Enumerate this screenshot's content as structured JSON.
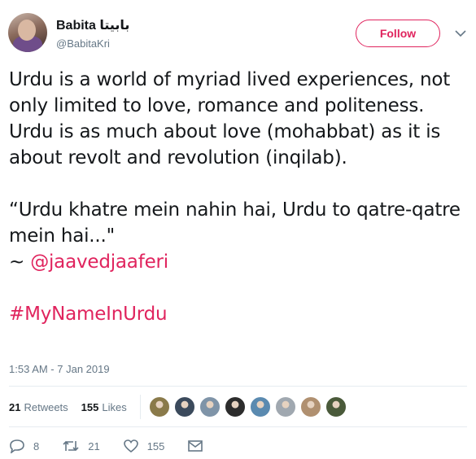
{
  "author": {
    "display_name": "Babita بابیتا",
    "handle": "@BabitaKri"
  },
  "follow_label": "Follow",
  "tweet": {
    "para1": "Urdu is a world of myriad lived experiences, not only limited to love, romance and politeness. Urdu is as much about love (mohabbat) as it is about revolt and revolution (inqilab).",
    "quote": "“Urdu khatre mein nahin hai, Urdu to qatre-qatre mein hai...\"",
    "tilde": "~ ",
    "mention": "@jaavedjaaferi",
    "hashtag": "#MyNameInUrdu"
  },
  "timestamp": "1:53 AM - 7 Jan 2019",
  "stats": {
    "retweets_count": "21",
    "retweets_label": "Retweets",
    "likes_count": "155",
    "likes_label": "Likes"
  },
  "likers_colors": [
    "#8a7a4a",
    "#3b4a5c",
    "#7f94a8",
    "#2c2c2c",
    "#5a8ab0",
    "#a0a8b0",
    "#b09070",
    "#4a5a3a"
  ],
  "actions": {
    "reply_count": "8",
    "retweet_count": "21",
    "like_count": "155"
  },
  "colors": {
    "accent": "#e0245e",
    "muted": "#657786"
  }
}
